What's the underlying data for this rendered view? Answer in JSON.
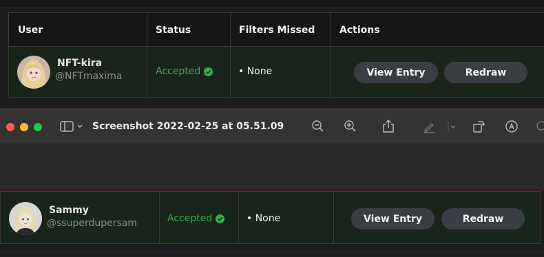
{
  "table": {
    "headers": {
      "user": "User",
      "status": "Status",
      "filters": "Filters Missed",
      "actions": "Actions"
    },
    "rows": [
      {
        "name": "NFT-kira",
        "handle": "@NFTmaxima",
        "status": "Accepted",
        "filters": "• None",
        "view_label": "View Entry",
        "redraw_label": "Redraw"
      },
      {
        "name": "Sammy",
        "handle": "@ssuperdupersam",
        "status": "Accepted",
        "filters": "• None",
        "view_label": "View Entry",
        "redraw_label": "Redraw"
      }
    ]
  },
  "preview_window": {
    "title": "Screenshot 2022-02-25 at 05.51.09",
    "toolbar_icons": [
      "sidebar-icon",
      "zoom-out-icon",
      "zoom-in-icon",
      "share-icon",
      "markup-icon",
      "rotate-icon",
      "annotate-icon",
      "search-icon"
    ]
  },
  "colors": {
    "accepted": "#38b045",
    "row_bg": "#18251a",
    "button_bg": "#3a3e44",
    "close": "#ff5f57",
    "minimize": "#febc2e",
    "zoom": "#28c840"
  }
}
